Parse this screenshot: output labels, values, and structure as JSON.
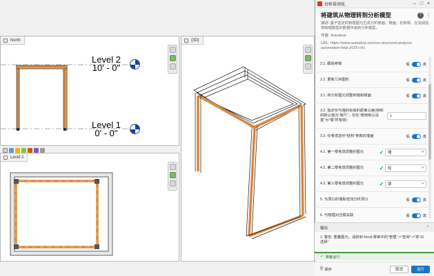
{
  "viewports": {
    "plan_view": {
      "tab_label": "North"
    },
    "view_3d": {
      "tab_label": "{3D}"
    },
    "level2_view": {
      "tab_label": "Level 2"
    },
    "levels": [
      {
        "name": "Level 2",
        "elevation": "10' - 0\""
      },
      {
        "name": "Level 1",
        "elevation": "0' - 0\""
      }
    ]
  },
  "panel": {
    "window_title": "分析自动化",
    "title": "将建筑从物理转到分析模型",
    "description_label": "描述:",
    "description": "基于选定的物理图元生成分析楼面、楼面、柱和梁、在完成后将物理模型的数据传递到分析模型。",
    "author_label": "作者:",
    "author": "Autodesk",
    "url_label": "URL:",
    "url": "https://www.autodesk.com/ca-structural-analysis-automation-help-2025-chs",
    "toggle_off_label": "假",
    "toggle_on_label": "真",
    "params": [
      {
        "label": "2.1. 跟踪参数",
        "kind": "toggle"
      },
      {
        "label": "2.2. 更新几何图形",
        "kind": "toggle"
      },
      {
        "label": "3.1. 将分析图元调整到墙和楼面",
        "kind": "toggle"
      },
      {
        "label": "3.2. 指定仅与墙的标高的距离公差(英制的默认值为\"英尺\"，仅在\"使用默认设置\"为\"假\"时有效)",
        "kind": "number",
        "value": "1"
      },
      {
        "label": "3.3. 仅考虑选中\"结构\"参数的墙面",
        "kind": "toggle"
      },
      {
        "label": "4.1. 第一根考虑调整的图元",
        "kind": "dropdown",
        "value": "墙"
      },
      {
        "label": "4.2. 第二根考虑调整的图元",
        "kind": "dropdown",
        "value": "柱"
      },
      {
        "label": "4.3. 第三根考虑调整的图元",
        "kind": "dropdown",
        "value": "梁"
      },
      {
        "label": "5. 为洞口的墙板增加分析洞口",
        "kind": "toggle"
      },
      {
        "label": "6. 与物理对应模关联",
        "kind": "toggle"
      }
    ],
    "output": {
      "header": "输出",
      "message": "1. 警告: 重叠图元。请转到 Revit 菜单中的\"管理\"->\"查询\"->\"按 ID 选择\""
    },
    "status": "准备运行",
    "footer": {
      "save_label": "保存",
      "close_label": "取消",
      "run_label": "运行"
    }
  }
}
